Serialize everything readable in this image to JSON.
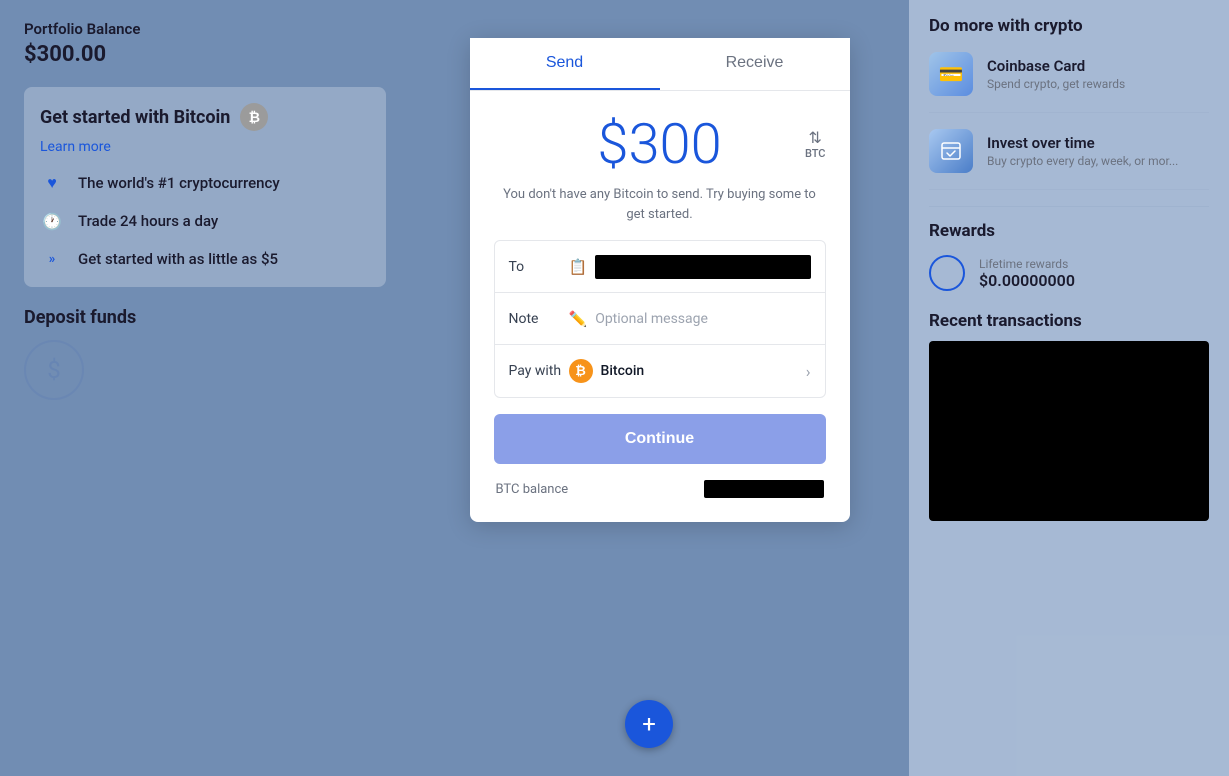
{
  "left": {
    "portfolio_label": "Portfolio Balance",
    "portfolio_amount": "$300.00",
    "get_started_title": "Get started with Bitcoin",
    "learn_more": "Learn more",
    "features": [
      {
        "icon": "♥",
        "text": "The world's #1 cryptocurrency"
      },
      {
        "icon": "🕐",
        "text": "Trade 24 hours a day"
      },
      {
        "icon": "»",
        "text": "Get started with as little as $5"
      }
    ],
    "deposit_funds_label": "Deposit funds"
  },
  "modal": {
    "tab_send": "Send",
    "tab_receive": "Receive",
    "amount": "$300",
    "currency_toggle_label": "BTC",
    "no_bitcoin_msg": "You don't have any Bitcoin to send. Try buying some to get started.",
    "to_label": "To",
    "note_label": "Note",
    "note_placeholder": "Optional message",
    "pay_with_label": "Pay with",
    "pay_with_currency": "Bitcoin",
    "continue_btn": "Continue",
    "btc_balance_label": "BTC balance"
  },
  "right": {
    "do_more_title": "Do more with crypto",
    "promos": [
      {
        "icon": "💳",
        "title": "Coinbase Card",
        "desc": "Spend crypto, get rewards"
      },
      {
        "icon": "📅",
        "title": "Invest over time",
        "desc": "Buy crypto every day, week, or mor..."
      }
    ],
    "rewards_title": "Rewards",
    "lifetime_rewards_label": "Lifetime rewards",
    "lifetime_rewards_amount": "$0.00000000",
    "recent_trans_title": "Recent transactions"
  }
}
